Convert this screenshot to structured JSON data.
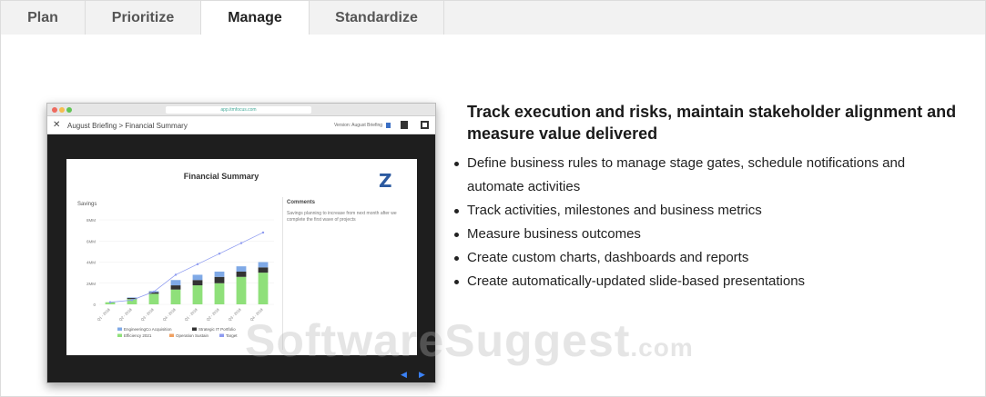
{
  "tabs": [
    {
      "label": "Plan",
      "active": false
    },
    {
      "label": "Prioritize",
      "active": false
    },
    {
      "label": "Manage",
      "active": true
    },
    {
      "label": "Standardize",
      "active": false
    }
  ],
  "screenshot": {
    "browser_url": "app.itmfocus.com",
    "breadcrumb": "August Briefing > Financial Summary",
    "version_text": "Version: August Briefing",
    "slide_title": "Financial Summary",
    "chart_label": "Savings",
    "comments_heading": "Comments",
    "comments_text": "Savings planning to increase from next month after we complete the first wave of projects",
    "chart_data": {
      "type": "bar",
      "categories": [
        "Q1 - 2018",
        "Q2 - 2018",
        "Q3 - 2018",
        "Q4 - 2018",
        "Q1 - 2019",
        "Q2 - 2019",
        "Q3 - 2019",
        "Q4 - 2019"
      ],
      "yticks": [
        "8MM",
        "6MM",
        "4MM",
        "2MM",
        "0"
      ],
      "ylim": [
        0,
        8
      ],
      "series": [
        {
          "name": "Efficiency 2021",
          "color": "#8fe07a",
          "values": [
            0.2,
            0.5,
            1.0,
            1.4,
            1.8,
            2.0,
            2.6,
            3.0
          ]
        },
        {
          "name": "Strategic IT Portfolio",
          "color": "#333333",
          "values": [
            0.0,
            0.1,
            0.15,
            0.4,
            0.5,
            0.6,
            0.5,
            0.5
          ]
        },
        {
          "name": "EngineeringCo Acquisition",
          "color": "#7fa9e6",
          "values": [
            0.0,
            0.05,
            0.1,
            0.5,
            0.5,
            0.5,
            0.5,
            0.5
          ]
        }
      ],
      "line_series": {
        "name": "Target",
        "color": "#8e9bf0",
        "values": [
          0.2,
          0.4,
          1.2,
          2.8,
          3.8,
          4.8,
          5.8,
          6.8
        ]
      },
      "legend": [
        "EngineeringCo Acquisition",
        "Strategic IT Portfolio",
        "Efficiency 2021",
        "Operation Sustain",
        "Target"
      ]
    }
  },
  "heading": "Track execution and risks, maintain stakeholder alignment and measure value delivered",
  "bullets": [
    "Define business rules to manage stage gates, schedule notifications and automate activities",
    "Track activities, milestones and business metrics",
    "Measure business outcomes",
    "Create custom charts, dashboards and reports",
    "Create automatically-updated slide-based presentations"
  ],
  "watermark": "SoftwareSuggest",
  "watermark_suffix": ".com"
}
